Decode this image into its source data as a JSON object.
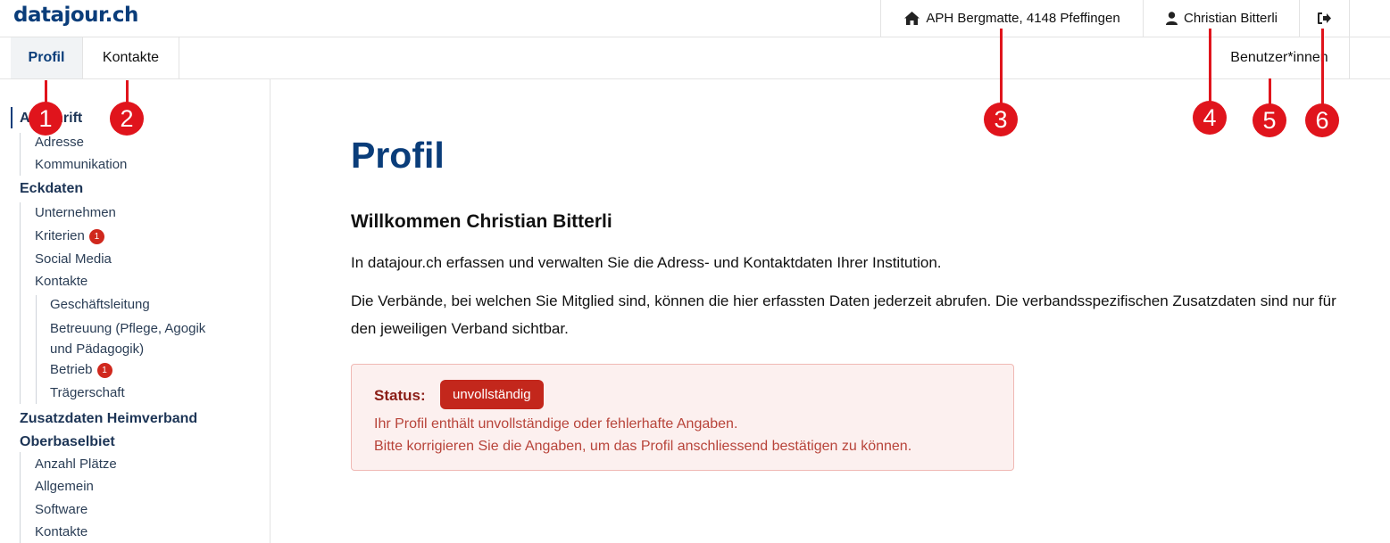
{
  "header": {
    "logo": "datajour.ch",
    "institution": "APH Bergmatte, 4148 Pfeffingen",
    "user": "Christian Bitterli",
    "home_icon": "home-icon",
    "user_icon": "user-icon",
    "logout_icon": "logout-icon"
  },
  "tabs": {
    "profil": "Profil",
    "kontakte": "Kontakte",
    "users": "Benutzer*innen"
  },
  "sidebar": {
    "anschrift": "Anschrift",
    "adresse": "Adresse",
    "kommunikation": "Kommunikation",
    "eckdaten": "Eckdaten",
    "unternehmen": "Unternehmen",
    "kriterien": "Kriterien",
    "kriterien_badge": "1",
    "social_media": "Social Media",
    "kontakte": "Kontakte",
    "geschaeftsleitung": "Geschäftsleitung",
    "betreuung_1": "Betreuung (Pflege, Agogik",
    "betreuung_2": "und Pädagogik)",
    "betrieb": "Betrieb",
    "betrieb_badge": "1",
    "traegerschaft": "Trägerschaft",
    "zusatzdaten_1": "Zusatzdaten Heimverband",
    "zusatzdaten_2": "Oberbaselbiet",
    "anzahl_plaetze": "Anzahl Plätze",
    "allgemein": "Allgemein",
    "software": "Software",
    "kontakte2": "Kontakte"
  },
  "main": {
    "title": "Profil",
    "welcome": "Willkommen Christian Bitterli",
    "intro": "In datajour.ch erfassen und verwalten Sie die Adress- und Kontaktdaten Ihrer Institution.",
    "info": "Die Verbände, bei welchen Sie Mitglied sind, können die hier erfassten Daten jederzeit abrufen. Die verbandsspezifischen Zusatzdaten sind nur für den jeweiligen Verband sichtbar.",
    "status_label": "Status:",
    "status_value": "unvollständig",
    "status_line1": "Ihr Profil enthält unvollständige oder fehlerhafte Angaben.",
    "status_line2": "Bitte korrigieren Sie die Angaben, um das Profil anschliessend bestätigen zu können."
  },
  "markers": [
    "1",
    "2",
    "3",
    "4",
    "5",
    "6"
  ],
  "colors": {
    "brand": "#0a3d7a",
    "marker": "#e0141c",
    "status_badge": "#c3271c",
    "alert_bg": "#fcf0ef"
  }
}
